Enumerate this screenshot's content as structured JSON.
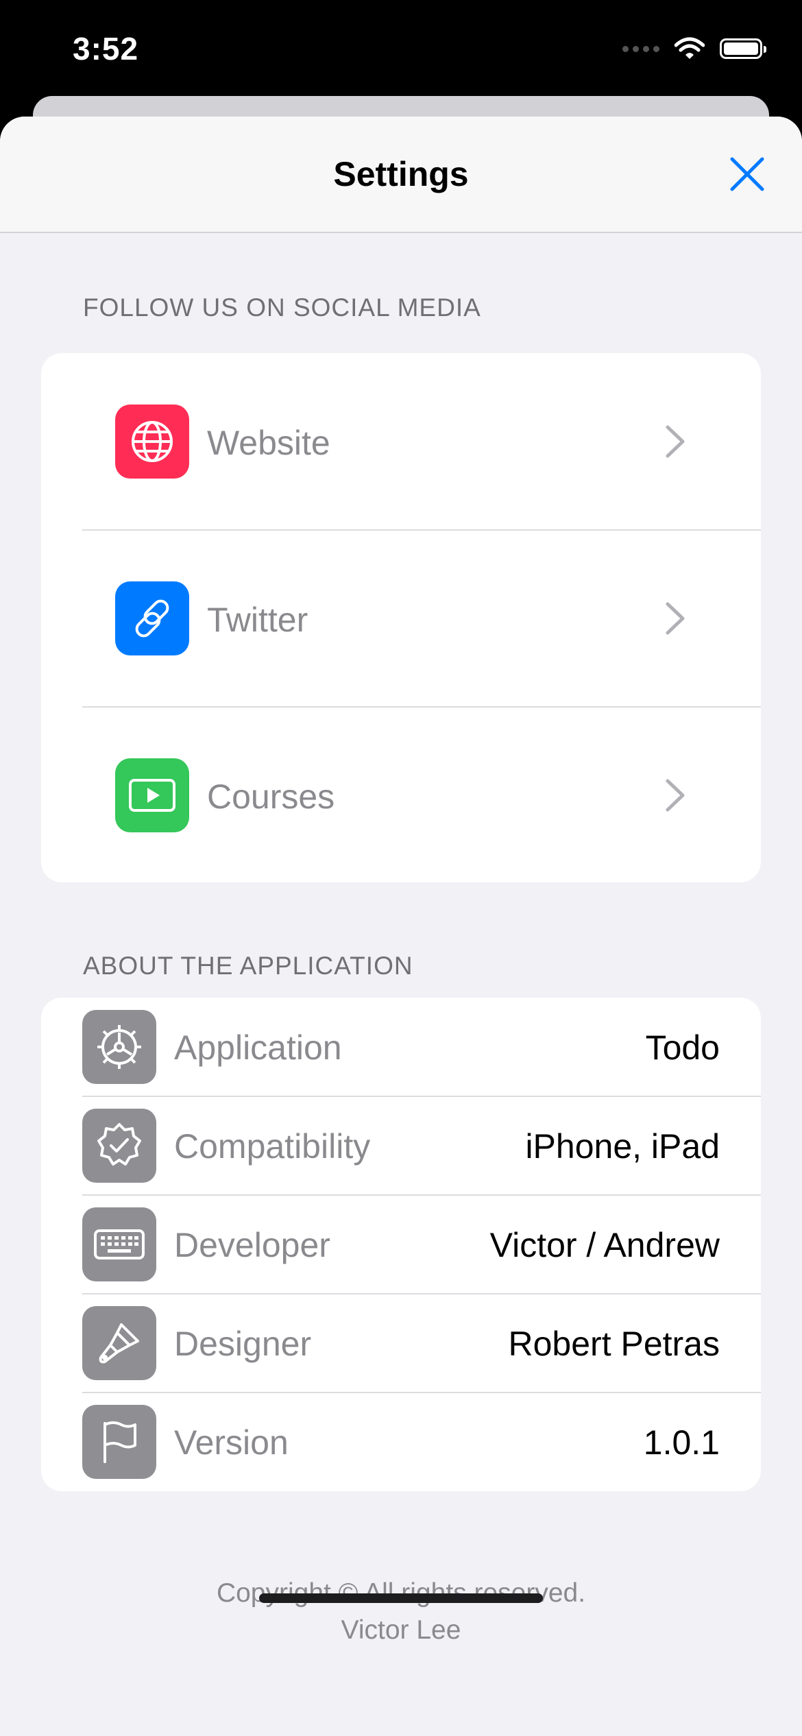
{
  "status_bar": {
    "time": "3:52"
  },
  "nav": {
    "title": "Settings"
  },
  "social": {
    "header": "FOLLOW US ON SOCIAL MEDIA",
    "items": [
      {
        "label": "Website",
        "icon": "globe-icon",
        "color": "#ff2d55"
      },
      {
        "label": "Twitter",
        "icon": "link-icon",
        "color": "#007aff"
      },
      {
        "label": "Courses",
        "icon": "play-rectangle-icon",
        "color": "#34c759"
      }
    ]
  },
  "about": {
    "header": "ABOUT THE APPLICATION",
    "items": [
      {
        "label": "Application",
        "value": "Todo",
        "icon": "gear-icon"
      },
      {
        "label": "Compatibility",
        "value": "iPhone, iPad",
        "icon": "checkmark-seal-icon"
      },
      {
        "label": "Developer",
        "value": "Victor / Andrew",
        "icon": "keyboard-icon"
      },
      {
        "label": "Designer",
        "value": "Robert Petras",
        "icon": "paintbrush-icon"
      },
      {
        "label": "Version",
        "value": "1.0.1",
        "icon": "flag-icon"
      }
    ]
  },
  "footer": {
    "copyright": "Copyright © All rights reserved.",
    "author": "Victor Lee"
  },
  "colors": {
    "accent": "#007aff",
    "icon_gray": "#8e8e93"
  }
}
